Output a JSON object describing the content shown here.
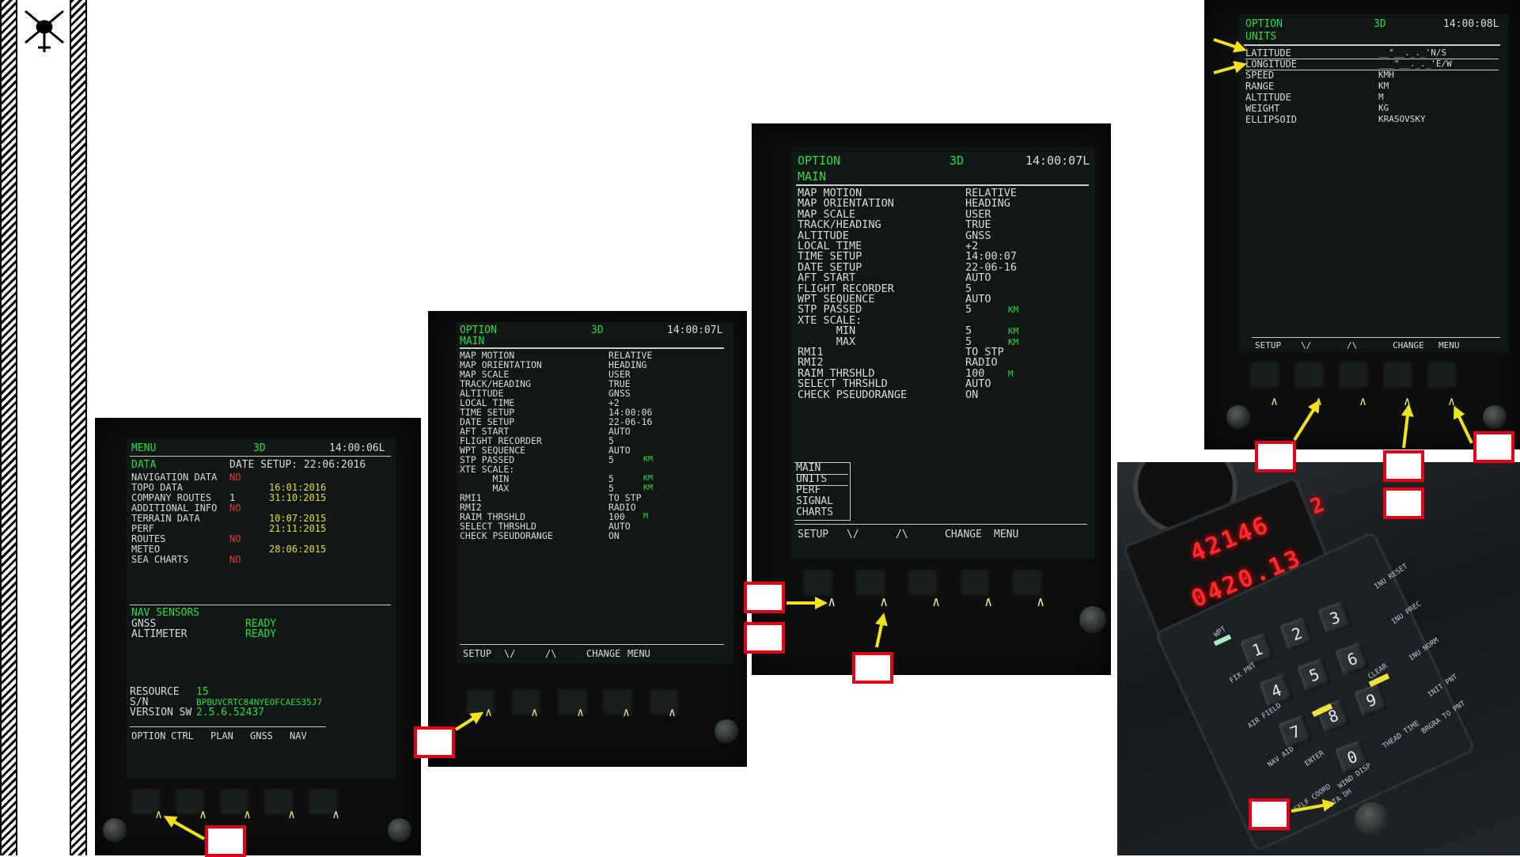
{
  "logo": {
    "icon": "helicopter-icon"
  },
  "screen1": {
    "header": {
      "page": "MENU",
      "mode": "3D",
      "time": "14:00:06L"
    },
    "section": "DATA",
    "date_setup": "DATE SETUP: 22:06:2016",
    "rows": [
      {
        "label": "NAVIGATION DATA",
        "count": "",
        "status": "NO",
        "date": ""
      },
      {
        "label": "TOPO DATA",
        "count": "",
        "status": "",
        "date": "16:01:2016"
      },
      {
        "label": "COMPANY ROUTES",
        "count": "1",
        "status": "",
        "date": "31:10:2015"
      },
      {
        "label": "ADDITIONAL INFO",
        "count": "",
        "status": "NO",
        "date": ""
      },
      {
        "label": "TERRAIN DATA",
        "count": "",
        "status": "",
        "date": "10:07:2015"
      },
      {
        "label": "PERF",
        "count": "",
        "status": "",
        "date": "21:11:2015"
      },
      {
        "label": "ROUTES",
        "count": "",
        "status": "NO",
        "date": ""
      },
      {
        "label": "METEO",
        "count": "",
        "status": "",
        "date": "28:06:2015"
      },
      {
        "label": "SEA CHARTS",
        "count": "",
        "status": "NO",
        "date": ""
      }
    ],
    "sensors_title": "NAV SENSORS",
    "sensors": [
      {
        "label": "GNSS",
        "status": "READY"
      },
      {
        "label": "ALTIMETER",
        "status": "READY"
      }
    ],
    "resource_label": "RESOURCE",
    "resource_value": "15",
    "sn_label": "S/N",
    "sn_value": "BPBUVCRTC84NYEOFCAES35J7",
    "version_label": "VERSION SW",
    "version_value": "2.5.6.52437",
    "softkeys": [
      "OPTION",
      "CTRL",
      "PLAN",
      "GNSS",
      "NAV"
    ]
  },
  "screen2": {
    "header": {
      "page": "OPTION",
      "mode": "3D",
      "time": "14:00:07L"
    },
    "section": "MAIN",
    "rows": [
      {
        "label": "MAP MOTION",
        "value": "RELATIVE",
        "unit": ""
      },
      {
        "label": "MAP ORIENTATION",
        "value": "HEADING",
        "unit": ""
      },
      {
        "label": "MAP SCALE",
        "value": "USER",
        "unit": ""
      },
      {
        "label": "TRACK/HEADING",
        "value": "TRUE",
        "unit": ""
      },
      {
        "label": "ALTITUDE",
        "value": "GNSS",
        "unit": ""
      },
      {
        "label": "LOCAL TIME",
        "value": "+2",
        "unit": ""
      },
      {
        "label": "TIME SETUP",
        "value": "14:00:06",
        "unit": ""
      },
      {
        "label": "DATE SETUP",
        "value": "22-06-16",
        "unit": ""
      },
      {
        "label": "AFT START",
        "value": "AUTO",
        "unit": ""
      },
      {
        "label": "FLIGHT RECORDER",
        "value": "5",
        "unit": ""
      },
      {
        "label": "WPT SEQUENCE",
        "value": "AUTO",
        "unit": ""
      },
      {
        "label": "STP PASSED",
        "value": "5",
        "unit": "KM"
      },
      {
        "label": "XTE SCALE:",
        "value": "",
        "unit": ""
      },
      {
        "label": "      MIN",
        "value": "5",
        "unit": "KM"
      },
      {
        "label": "      MAX",
        "value": "5",
        "unit": "KM"
      },
      {
        "label": "RMI1",
        "value": "TO STP",
        "unit": ""
      },
      {
        "label": "RMI2",
        "value": "RADIO",
        "unit": ""
      },
      {
        "label": "RAIM THRSHLD",
        "value": "100",
        "unit": "M"
      },
      {
        "label": "SELECT THRSHLD",
        "value": "AUTO",
        "unit": ""
      },
      {
        "label": "CHECK PSEUDORANGE",
        "value": "ON",
        "unit": ""
      }
    ],
    "softkeys": [
      "SETUP",
      "\\/",
      "/\\",
      "CHANGE",
      "MENU"
    ]
  },
  "screen3": {
    "header": {
      "page": "OPTION",
      "mode": "3D",
      "time": "14:00:07L"
    },
    "section": "MAIN",
    "rows": [
      {
        "label": "MAP MOTION",
        "value": "RELATIVE",
        "unit": ""
      },
      {
        "label": "MAP ORIENTATION",
        "value": "HEADING",
        "unit": ""
      },
      {
        "label": "MAP SCALE",
        "value": "USER",
        "unit": ""
      },
      {
        "label": "TRACK/HEADING",
        "value": "TRUE",
        "unit": ""
      },
      {
        "label": "ALTITUDE",
        "value": "GNSS",
        "unit": ""
      },
      {
        "label": "LOCAL TIME",
        "value": "+2",
        "unit": ""
      },
      {
        "label": "TIME SETUP",
        "value": "14:00:07",
        "unit": ""
      },
      {
        "label": "DATE SETUP",
        "value": "22-06-16",
        "unit": ""
      },
      {
        "label": "AFT START",
        "value": "AUTO",
        "unit": ""
      },
      {
        "label": "FLIGHT RECORDER",
        "value": "5",
        "unit": ""
      },
      {
        "label": "WPT SEQUENCE",
        "value": "AUTO",
        "unit": ""
      },
      {
        "label": "STP PASSED",
        "value": "5",
        "unit": "KM"
      },
      {
        "label": "XTE SCALE:",
        "value": "",
        "unit": ""
      },
      {
        "label": "      MIN",
        "value": "5",
        "unit": "KM"
      },
      {
        "label": "      MAX",
        "value": "5",
        "unit": "KM"
      },
      {
        "label": "RMI1",
        "value": "TO STP",
        "unit": ""
      },
      {
        "label": "RMI2",
        "value": "RADIO",
        "unit": ""
      },
      {
        "label": "RAIM THRSHLD",
        "value": "100",
        "unit": "M"
      },
      {
        "label": "SELECT THRSHLD",
        "value": "AUTO",
        "unit": ""
      },
      {
        "label": "CHECK PSEUDORANGE",
        "value": "ON",
        "unit": ""
      }
    ],
    "submenu": [
      "MAIN",
      "UNITS",
      "PERF",
      "SIGNAL",
      "CHARTS"
    ],
    "softkeys": [
      "SETUP",
      "\\/",
      "/\\",
      "CHANGE",
      "MENU"
    ]
  },
  "screen4": {
    "header": {
      "page": "OPTION",
      "mode": "3D",
      "time": "14:00:08L"
    },
    "section": "UNITS",
    "rows": [
      {
        "label": "LATITUDE",
        "value": "__°__._._'N/S"
      },
      {
        "label": "LONGITUDE",
        "value": "___°__._._'E/W"
      },
      {
        "label": "SPEED",
        "value": "KMH"
      },
      {
        "label": "RANGE",
        "value": "KM"
      },
      {
        "label": "ALTITUDE",
        "value": "M"
      },
      {
        "label": "WEIGHT",
        "value": "KG"
      },
      {
        "label": "ELLIPSOID",
        "value": "KRASOVSKY"
      }
    ],
    "softkeys": [
      "SETUP",
      "\\/",
      "/\\",
      "CHANGE",
      "MENU"
    ]
  },
  "keypad": {
    "display_line1": "42146",
    "display_line1_suffix": "2",
    "display_line2": "0420.13",
    "keys": [
      "1",
      "2",
      "3",
      "4",
      "5",
      "6",
      "7",
      "8",
      "9",
      "0"
    ],
    "labels": [
      "WPT",
      "FIX PNT",
      "AIR FIELD",
      "NAV AID",
      "SELF COORD",
      "ENTER",
      "CLEAR",
      "INU RESET",
      "INU PREC",
      "INU NORM",
      "WIND DISP",
      "DTA DH",
      "INIT PNT",
      "THEAD TIME",
      "BRGRA TO PNT"
    ],
    "colors": {
      "display": "#ff2a2a",
      "screen_green": "#2ddb43",
      "screen_yellow": "#e5df27",
      "highlight": "#e2001a",
      "arrow": "#f2e21c"
    }
  }
}
